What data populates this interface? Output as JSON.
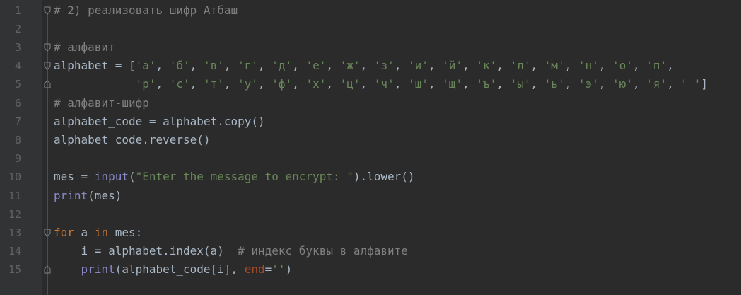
{
  "editor": {
    "lines": [
      {
        "n": "1",
        "fold": "start",
        "tokens": [
          {
            "t": "# 2) реализовать шифр Атбаш",
            "c": "comment"
          }
        ]
      },
      {
        "n": "2",
        "fold": "",
        "tokens": []
      },
      {
        "n": "3",
        "fold": "start",
        "tokens": [
          {
            "t": "# алфавит",
            "c": "comment"
          }
        ]
      },
      {
        "n": "4",
        "fold": "start",
        "tokens": [
          {
            "t": "alphabet = [",
            "c": "plain"
          },
          {
            "t": "'а'",
            "c": "str"
          },
          {
            "t": ", ",
            "c": "plain"
          },
          {
            "t": "'б'",
            "c": "str"
          },
          {
            "t": ", ",
            "c": "plain"
          },
          {
            "t": "'в'",
            "c": "str"
          },
          {
            "t": ", ",
            "c": "plain"
          },
          {
            "t": "'г'",
            "c": "str"
          },
          {
            "t": ", ",
            "c": "plain"
          },
          {
            "t": "'д'",
            "c": "str"
          },
          {
            "t": ", ",
            "c": "plain"
          },
          {
            "t": "'е'",
            "c": "str"
          },
          {
            "t": ", ",
            "c": "plain"
          },
          {
            "t": "'ж'",
            "c": "str"
          },
          {
            "t": ", ",
            "c": "plain"
          },
          {
            "t": "'з'",
            "c": "str"
          },
          {
            "t": ", ",
            "c": "plain"
          },
          {
            "t": "'и'",
            "c": "str"
          },
          {
            "t": ", ",
            "c": "plain"
          },
          {
            "t": "'й'",
            "c": "str"
          },
          {
            "t": ", ",
            "c": "plain"
          },
          {
            "t": "'к'",
            "c": "str"
          },
          {
            "t": ", ",
            "c": "plain"
          },
          {
            "t": "'л'",
            "c": "str"
          },
          {
            "t": ", ",
            "c": "plain"
          },
          {
            "t": "'м'",
            "c": "str"
          },
          {
            "t": ", ",
            "c": "plain"
          },
          {
            "t": "'н'",
            "c": "str"
          },
          {
            "t": ", ",
            "c": "plain"
          },
          {
            "t": "'о'",
            "c": "str"
          },
          {
            "t": ", ",
            "c": "plain"
          },
          {
            "t": "'п'",
            "c": "str"
          },
          {
            "t": ",",
            "c": "plain"
          }
        ]
      },
      {
        "n": "5",
        "fold": "end",
        "tokens": [
          {
            "t": "            ",
            "c": "plain"
          },
          {
            "t": "'р'",
            "c": "str"
          },
          {
            "t": ", ",
            "c": "plain"
          },
          {
            "t": "'с'",
            "c": "str"
          },
          {
            "t": ", ",
            "c": "plain"
          },
          {
            "t": "'т'",
            "c": "str"
          },
          {
            "t": ", ",
            "c": "plain"
          },
          {
            "t": "'у'",
            "c": "str"
          },
          {
            "t": ", ",
            "c": "plain"
          },
          {
            "t": "'ф'",
            "c": "str"
          },
          {
            "t": ", ",
            "c": "plain"
          },
          {
            "t": "'х'",
            "c": "str"
          },
          {
            "t": ", ",
            "c": "plain"
          },
          {
            "t": "'ц'",
            "c": "str"
          },
          {
            "t": ", ",
            "c": "plain"
          },
          {
            "t": "'ч'",
            "c": "str"
          },
          {
            "t": ", ",
            "c": "plain"
          },
          {
            "t": "'ш'",
            "c": "str"
          },
          {
            "t": ", ",
            "c": "plain"
          },
          {
            "t": "'щ'",
            "c": "str"
          },
          {
            "t": ", ",
            "c": "plain"
          },
          {
            "t": "'ъ'",
            "c": "str"
          },
          {
            "t": ", ",
            "c": "plain"
          },
          {
            "t": "'ы'",
            "c": "str"
          },
          {
            "t": ", ",
            "c": "plain"
          },
          {
            "t": "'ь'",
            "c": "str"
          },
          {
            "t": ", ",
            "c": "plain"
          },
          {
            "t": "'э'",
            "c": "str"
          },
          {
            "t": ", ",
            "c": "plain"
          },
          {
            "t": "'ю'",
            "c": "str"
          },
          {
            "t": ", ",
            "c": "plain"
          },
          {
            "t": "'я'",
            "c": "str"
          },
          {
            "t": ", ",
            "c": "plain"
          },
          {
            "t": "' '",
            "c": "str"
          },
          {
            "t": "]",
            "c": "plain"
          }
        ]
      },
      {
        "n": "6",
        "fold": "",
        "tokens": [
          {
            "t": "# алфавит-шифр",
            "c": "comment"
          }
        ]
      },
      {
        "n": "7",
        "fold": "",
        "tokens": [
          {
            "t": "alphabet_code = alphabet.copy()",
            "c": "plain"
          }
        ]
      },
      {
        "n": "8",
        "fold": "",
        "tokens": [
          {
            "t": "alphabet_code.reverse()",
            "c": "plain"
          }
        ]
      },
      {
        "n": "9",
        "fold": "",
        "tokens": []
      },
      {
        "n": "10",
        "fold": "",
        "tokens": [
          {
            "t": "mes = ",
            "c": "plain"
          },
          {
            "t": "input",
            "c": "builtin"
          },
          {
            "t": "(",
            "c": "plain"
          },
          {
            "t": "\"Enter the message to encrypt: \"",
            "c": "str"
          },
          {
            "t": ").lower()",
            "c": "plain"
          }
        ]
      },
      {
        "n": "11",
        "fold": "",
        "tokens": [
          {
            "t": "print",
            "c": "builtin"
          },
          {
            "t": "(mes)",
            "c": "plain"
          }
        ]
      },
      {
        "n": "12",
        "fold": "",
        "tokens": []
      },
      {
        "n": "13",
        "fold": "start",
        "tokens": [
          {
            "t": "for",
            "c": "kw"
          },
          {
            "t": " a ",
            "c": "plain"
          },
          {
            "t": "in",
            "c": "kw"
          },
          {
            "t": " mes:",
            "c": "plain"
          }
        ]
      },
      {
        "n": "14",
        "fold": "",
        "tokens": [
          {
            "t": "    i = alphabet.index(a)  ",
            "c": "plain"
          },
          {
            "t": "# индекс буквы в алфавите",
            "c": "comment"
          }
        ]
      },
      {
        "n": "15",
        "fold": "end",
        "tokens": [
          {
            "t": "    ",
            "c": "plain"
          },
          {
            "t": "print",
            "c": "builtin"
          },
          {
            "t": "(alphabet_code[i], ",
            "c": "plain"
          },
          {
            "t": "end",
            "c": "param"
          },
          {
            "t": "=",
            "c": "plain"
          },
          {
            "t": "''",
            "c": "str"
          },
          {
            "t": ")",
            "c": "plain"
          }
        ]
      }
    ]
  }
}
